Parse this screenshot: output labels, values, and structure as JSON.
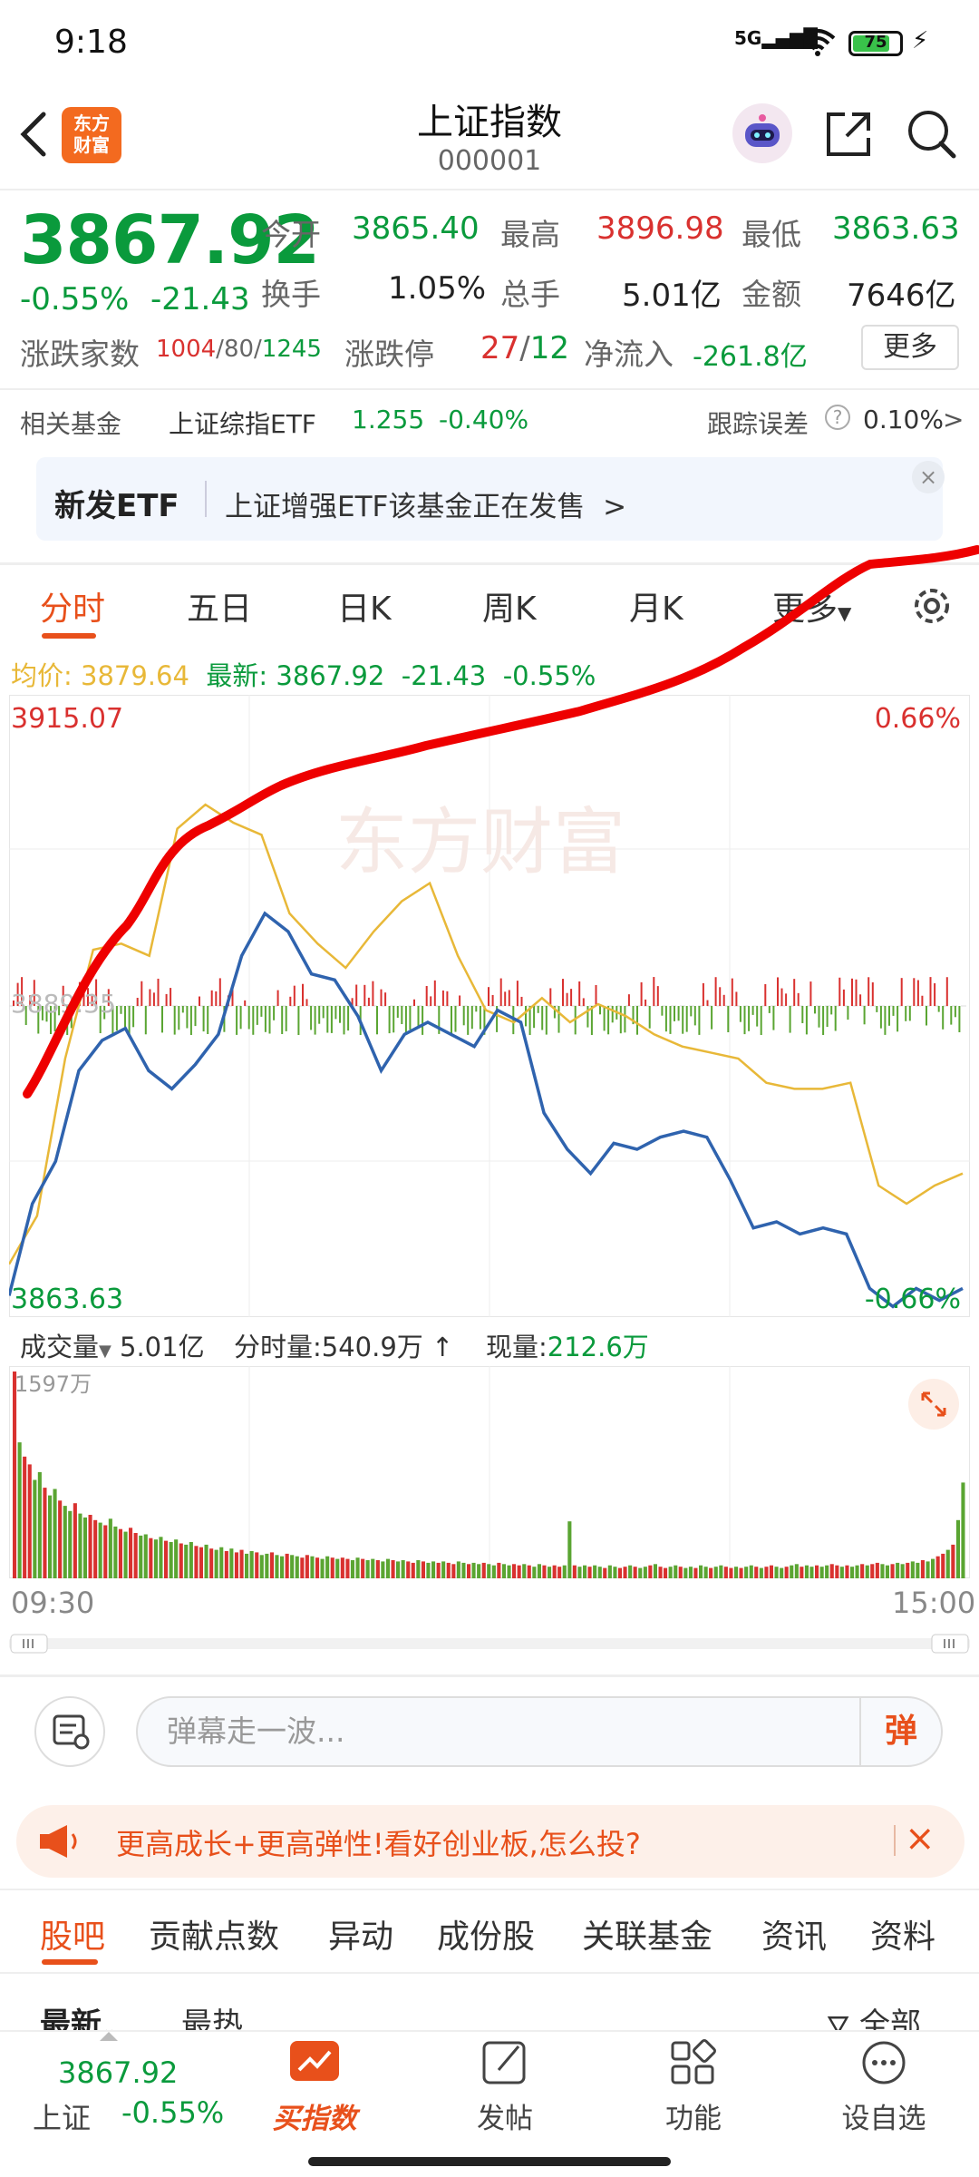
{
  "status_bar": {
    "time": "9:18",
    "signal": "5G",
    "battery": "75"
  },
  "header": {
    "title": "上证指数",
    "code": "000001",
    "logo_text_1": "东方",
    "logo_text_2": "财富"
  },
  "quote": {
    "price": "3867.92",
    "change_pct": "-0.55%",
    "change": "-21.43",
    "open_label": "今开",
    "open": "3865.40",
    "high_label": "最高",
    "high": "3896.98",
    "low_label": "最低",
    "low": "3863.63",
    "turnover_label": "换手",
    "turnover": "1.05%",
    "volume_label": "总手",
    "volume": "5.01亿",
    "amount_label": "金额",
    "amount": "7646亿",
    "adv_dec_label": "涨跌家数",
    "adv": "1004",
    "flat": "80",
    "dec": "1245",
    "limit_label": "涨跌停",
    "limit_up": "27",
    "limit_down": "12",
    "inflow_label": "净流入",
    "inflow": "-261.8亿",
    "more_button": "更多"
  },
  "fund": {
    "label": "相关基金",
    "name": "上证综指ETF",
    "price": "1.255",
    "change": "-0.40%",
    "tracking_label": "跟踪误差",
    "tracking_value": "0.10%",
    "arrow": ">"
  },
  "etf_banner": {
    "title": "新发ETF",
    "text": "上证增强ETF该基金正在发售",
    "arrow": ">",
    "close": "×"
  },
  "tabs": [
    "分时",
    "五日",
    "日K",
    "周K",
    "月K",
    "更多"
  ],
  "intraday": {
    "avg_label": "均价:",
    "avg": "3879.64",
    "latest_label": "最新:",
    "latest": "3867.92",
    "latest_change": "-21.43",
    "latest_pct": "-0.55%",
    "top_price": "3915.07",
    "top_pct": "0.66%",
    "bottom_price": "3863.63",
    "bottom_pct": "-0.66%",
    "mid_label": "3889.35",
    "watermark": "东方财富",
    "colors": {
      "price_line": "#2f63ae",
      "avg_line": "#e8b838",
      "up": "#d9312f",
      "down": "#5aa532",
      "annotation": "#ee0000"
    }
  },
  "chart_data": {
    "type": "line",
    "xlabel": "",
    "ylabel": "",
    "x_range": [
      "09:30",
      "15:00"
    ],
    "ylim": [
      3863.63,
      3915.07
    ],
    "series": [
      {
        "values": [
          3865.4,
          3873.0,
          3876.5,
          3884.0,
          3886.5,
          3887.5,
          3884.0,
          3882.5,
          3884.5,
          3887.0,
          3893.5,
          3897.0,
          3895.5,
          3892.0,
          3891.5,
          3888.5,
          3884.0,
          3887.0,
          3888.0,
          3887.0,
          3886.0,
          3889.0,
          3888.0,
          3880.5,
          3877.5,
          3875.5,
          3878.0,
          3877.5,
          3878.5,
          3879.0,
          3878.5,
          3875.0,
          3871.0,
          3871.5,
          3870.5,
          3871.0,
          3870.5,
          3866.0,
          3864.5,
          3866.0,
          3865.0,
          3866.0
        ]
      },
      {
        "values": [
          3868.0,
          3872.0,
          3885.0,
          3894.0,
          3894.5,
          3893.5,
          3904.0,
          3906.0,
          3904.5,
          3903.5,
          3897.0,
          3894.5,
          3892.5,
          3895.5,
          3898.0,
          3899.5,
          3893.5,
          3889.0,
          3888.0,
          3890.0,
          3888.0,
          3889.5,
          3888.5,
          3887.0,
          3886.0,
          3885.5,
          3885.0,
          3883.0,
          3882.5,
          3882.5,
          3883.0,
          3874.5,
          3873.0,
          3874.5,
          3875.5
        ]
      }
    ]
  },
  "volume": {
    "label": "成交量",
    "total": "5.01亿",
    "minute_label": "分时量:",
    "minute": "540.9万",
    "current_label": "现量:",
    "current": "212.6万",
    "max": "1597万",
    "start_time": "09:30",
    "end_time": "15:00",
    "bars": [
      1597,
      1050,
      940,
      880,
      760,
      820,
      700,
      640,
      690,
      600,
      560,
      520,
      580,
      500,
      470,
      490,
      450,
      430,
      410,
      460,
      400,
      380,
      360,
      390,
      350,
      330,
      340,
      310,
      300,
      320,
      290,
      280,
      300,
      270,
      260,
      280,
      250,
      240,
      260,
      230,
      220,
      240,
      210,
      230,
      200,
      220,
      190,
      210,
      200,
      180,
      190,
      200,
      180,
      170,
      190,
      180,
      170,
      160,
      180,
      170,
      160,
      150,
      170,
      160,
      150,
      160,
      150,
      140,
      160,
      150,
      140,
      150,
      140,
      130,
      150,
      140,
      130,
      140,
      130,
      120,
      140,
      130,
      120,
      130,
      120,
      130,
      120,
      110,
      130,
      120,
      110,
      120,
      110,
      120,
      110,
      100,
      120,
      110,
      100,
      110,
      100,
      110,
      100,
      90,
      110,
      100,
      90,
      100,
      90,
      100,
      440,
      100,
      90,
      100,
      90,
      100,
      90,
      80,
      100,
      90,
      80,
      90,
      100,
      90,
      80,
      90,
      100,
      110,
      90,
      80,
      90,
      100,
      90,
      80,
      90,
      80,
      100,
      90,
      80,
      90,
      100,
      90,
      80,
      90,
      80,
      90,
      100,
      90,
      80,
      90,
      100,
      90,
      80,
      90,
      100,
      110,
      90,
      100,
      90,
      100,
      90,
      100,
      110,
      100,
      90,
      100,
      90,
      100,
      110,
      100,
      110,
      120,
      110,
      100,
      110,
      120,
      110,
      120,
      130,
      120,
      140,
      130,
      150,
      170,
      190,
      220,
      260,
      450,
      740
    ]
  },
  "barrage": {
    "placeholder": "弹幕走一波...",
    "button": "弹"
  },
  "promo": {
    "text": "更高成长+更高弹性!看好创业板,怎么投?",
    "close": "×"
  },
  "bottom_tabs": [
    "股吧",
    "贡献点数",
    "异动",
    "成份股",
    "关联基金",
    "资讯",
    "资料"
  ],
  "sub_tabs": {
    "latest": "最新",
    "hot": "最热",
    "all": "全部"
  },
  "bottom_nav": {
    "price": "3867.92",
    "name": "上证",
    "change": "-0.55%",
    "items": [
      "买指数",
      "发帖",
      "功能",
      "设自选"
    ]
  }
}
